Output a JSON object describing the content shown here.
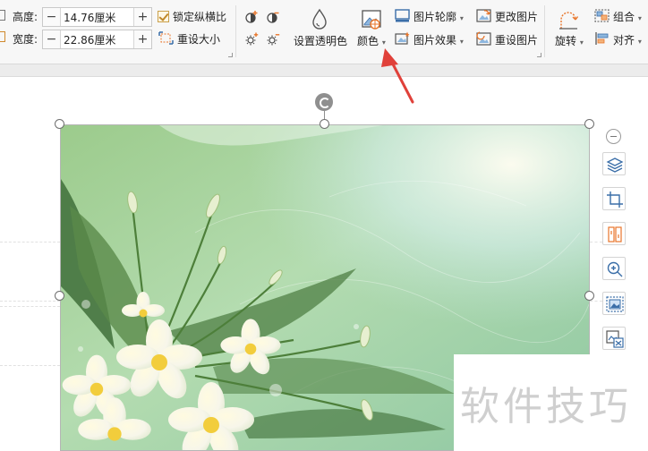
{
  "size": {
    "height_label": "高度:",
    "height_value": "14.76厘米",
    "width_label": "宽度:",
    "width_value": "22.86厘米",
    "lock_ratio_label": "锁定纵横比",
    "lock_ratio_checked": true,
    "reset_size_label": "重设大小"
  },
  "adjust": {
    "set_transparent_label": "设置透明色",
    "color_label": "颜色"
  },
  "picture_tools": {
    "outline_label": "图片轮廓",
    "effects_label": "图片效果",
    "change_label": "更改图片",
    "reset_label": "重设图片"
  },
  "arrange": {
    "rotate_label": "旋转",
    "group_label": "组合",
    "align_label": "对齐"
  },
  "watermark_text": "软件技巧",
  "colors": {
    "annotation_arrow": "#e0413a",
    "accent_icon": "#e8762b",
    "icon_blue": "#3a6ea8"
  },
  "side_tools": [
    "collapse-icon",
    "layers-icon",
    "crop-icon",
    "transform-icon",
    "zoom-icon",
    "image-select-icon",
    "image-text-icon"
  ]
}
